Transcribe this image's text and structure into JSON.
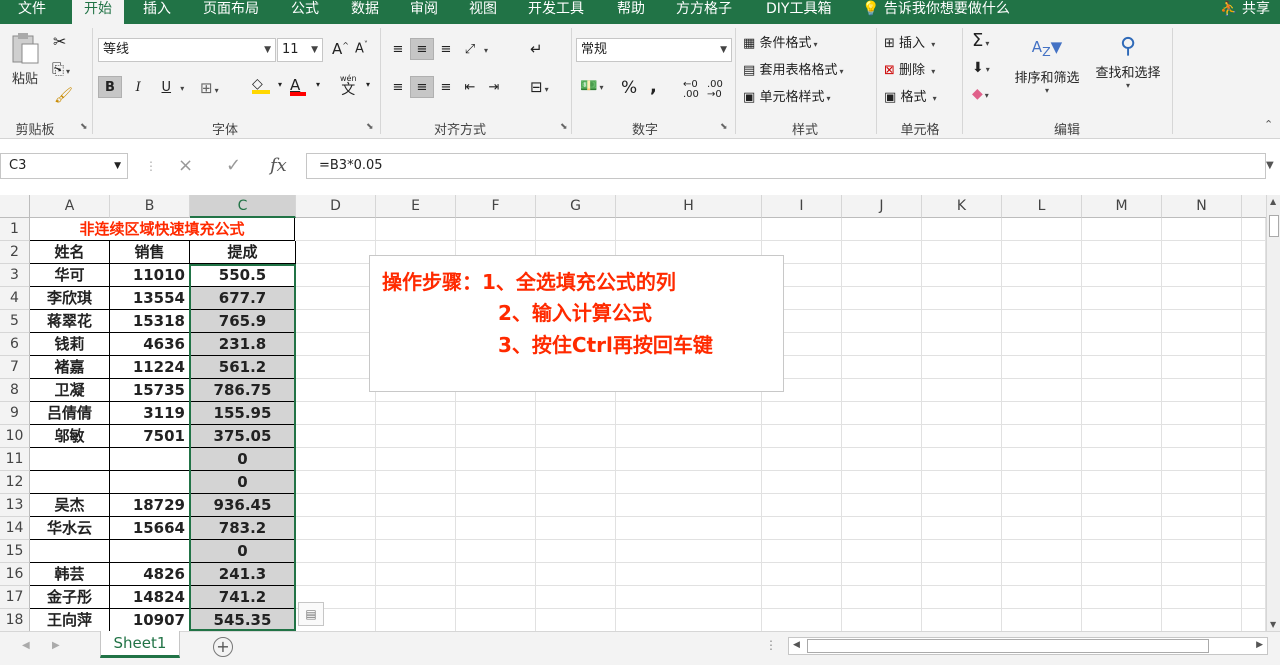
{
  "ribbon_tabs": [
    "文件",
    "开始",
    "插入",
    "页面布局",
    "公式",
    "数据",
    "审阅",
    "视图",
    "开发工具",
    "帮助",
    "方方格子",
    "DIY工具箱"
  ],
  "active_tab": "开始",
  "tell_me": "告诉我你想要做什么",
  "share": "共享",
  "clipboard": {
    "paste": "粘贴",
    "label": "剪贴板"
  },
  "font": {
    "name": "等线",
    "size": "11",
    "bold": "B",
    "italic": "I",
    "underline": "U",
    "label": "字体",
    "wen": "wén",
    "font_color_letter": "A"
  },
  "alignment": {
    "label": "对齐方式"
  },
  "number": {
    "format": "常规",
    "percent": "%",
    "comma": ",",
    "label": "数字"
  },
  "styles": {
    "conditional": "条件格式",
    "table": "套用表格格式",
    "cell_style": "单元格样式",
    "label": "样式"
  },
  "cells": {
    "insert": "插入",
    "delete": "删除",
    "format": "格式",
    "label": "单元格"
  },
  "editing": {
    "sort_filter": "排序和筛选",
    "find_select": "查找和选择",
    "label": "编辑"
  },
  "colors": {
    "accent": "#217346",
    "note_text": "#ff2a00",
    "fill_yellow": "#ffd700",
    "font_red": "#ff0000"
  },
  "formula_bar": {
    "name_box": "C3",
    "formula": "=B3*0.05",
    "cancel": "×",
    "enter": "✓",
    "fx": "fx"
  },
  "columns": [
    "A",
    "B",
    "C",
    "D",
    "E",
    "F",
    "G",
    "H",
    "I",
    "J",
    "K",
    "L",
    "M",
    "N"
  ],
  "sheet_title": "非连续区域快速填充公式",
  "headers": [
    "姓名",
    "销售",
    "提成"
  ],
  "rows": [
    {
      "row": "1"
    },
    {
      "row": "2"
    },
    {
      "row": "3",
      "name": "华可",
      "sales": "11010",
      "commission": "550.5"
    },
    {
      "row": "4",
      "name": "李欣琪",
      "sales": "13554",
      "commission": "677.7"
    },
    {
      "row": "5",
      "name": "蒋翠花",
      "sales": "15318",
      "commission": "765.9"
    },
    {
      "row": "6",
      "name": "钱莉",
      "sales": "4636",
      "commission": "231.8"
    },
    {
      "row": "7",
      "name": "褚嘉",
      "sales": "11224",
      "commission": "561.2"
    },
    {
      "row": "8",
      "name": "卫凝",
      "sales": "15735",
      "commission": "786.75"
    },
    {
      "row": "9",
      "name": "吕倩倩",
      "sales": "3119",
      "commission": "155.95"
    },
    {
      "row": "10",
      "name": "邬敏",
      "sales": "7501",
      "commission": "375.05"
    },
    {
      "row": "11",
      "name": "",
      "sales": "",
      "commission": "0"
    },
    {
      "row": "12",
      "name": "",
      "sales": "",
      "commission": "0"
    },
    {
      "row": "13",
      "name": "吴杰",
      "sales": "18729",
      "commission": "936.45"
    },
    {
      "row": "14",
      "name": "华水云",
      "sales": "15664",
      "commission": "783.2"
    },
    {
      "row": "15",
      "name": "",
      "sales": "",
      "commission": "0"
    },
    {
      "row": "16",
      "name": "韩芸",
      "sales": "4826",
      "commission": "241.3"
    },
    {
      "row": "17",
      "name": "金子彤",
      "sales": "14824",
      "commission": "741.2"
    },
    {
      "row": "18",
      "name": "王向萍",
      "sales": "10907",
      "commission": "545.35"
    }
  ],
  "note_lines": [
    "操作步骤：1、全选填充公式的列",
    "2、输入计算公式",
    "3、按住Ctrl再按回车键"
  ],
  "sheet_tab": "Sheet1",
  "add_sheet": "⊕"
}
